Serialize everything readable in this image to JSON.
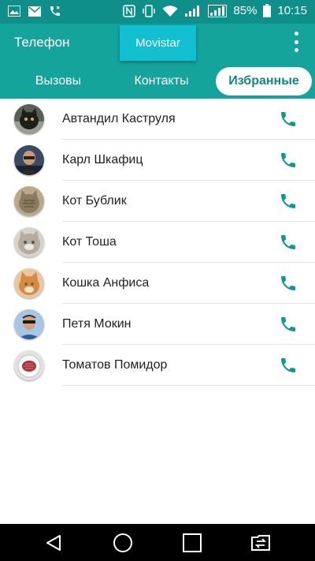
{
  "status": {
    "battery": "85%",
    "time": "10:15",
    "left_icons": [
      "gallery-icon",
      "mail-icon",
      "missed-call-icon"
    ],
    "right_icons": [
      "nfc-icon",
      "vibrate-icon",
      "wifi-icon",
      "signal-icon",
      "signal-icon",
      "battery-icon"
    ]
  },
  "header": {
    "title": "Телефон",
    "carrier": "Movistar",
    "menu_icon": "overflow-menu-icon"
  },
  "tabs": [
    {
      "label": "Вызовы",
      "active": false
    },
    {
      "label": "Контакты",
      "active": false
    },
    {
      "label": "Избранные",
      "active": true
    }
  ],
  "favorites": [
    {
      "name": "Автандил Каструля",
      "avatar": "black-cat-photo"
    },
    {
      "name": "Карл Шкафиц",
      "avatar": "man-photo"
    },
    {
      "name": "Кот Бублик",
      "avatar": "tabby-cat-photo"
    },
    {
      "name": "Кот Тоша",
      "avatar": "fluffy-cat-photo"
    },
    {
      "name": "Кошка Анфиса",
      "avatar": "ginger-cat-photo"
    },
    {
      "name": "Петя Мокин",
      "avatar": "man-sunglasses-photo"
    },
    {
      "name": "Томатов Помидор",
      "avatar": "tomato-plate-photo"
    }
  ],
  "colors": {
    "appbar": "#14a49c",
    "statusbar": "#0e8f8a",
    "carrier_button": "#12bfd0",
    "call_icon": "#14978f"
  },
  "nav": [
    "back-icon",
    "home-icon",
    "recents-icon",
    "sim-switch-icon"
  ]
}
